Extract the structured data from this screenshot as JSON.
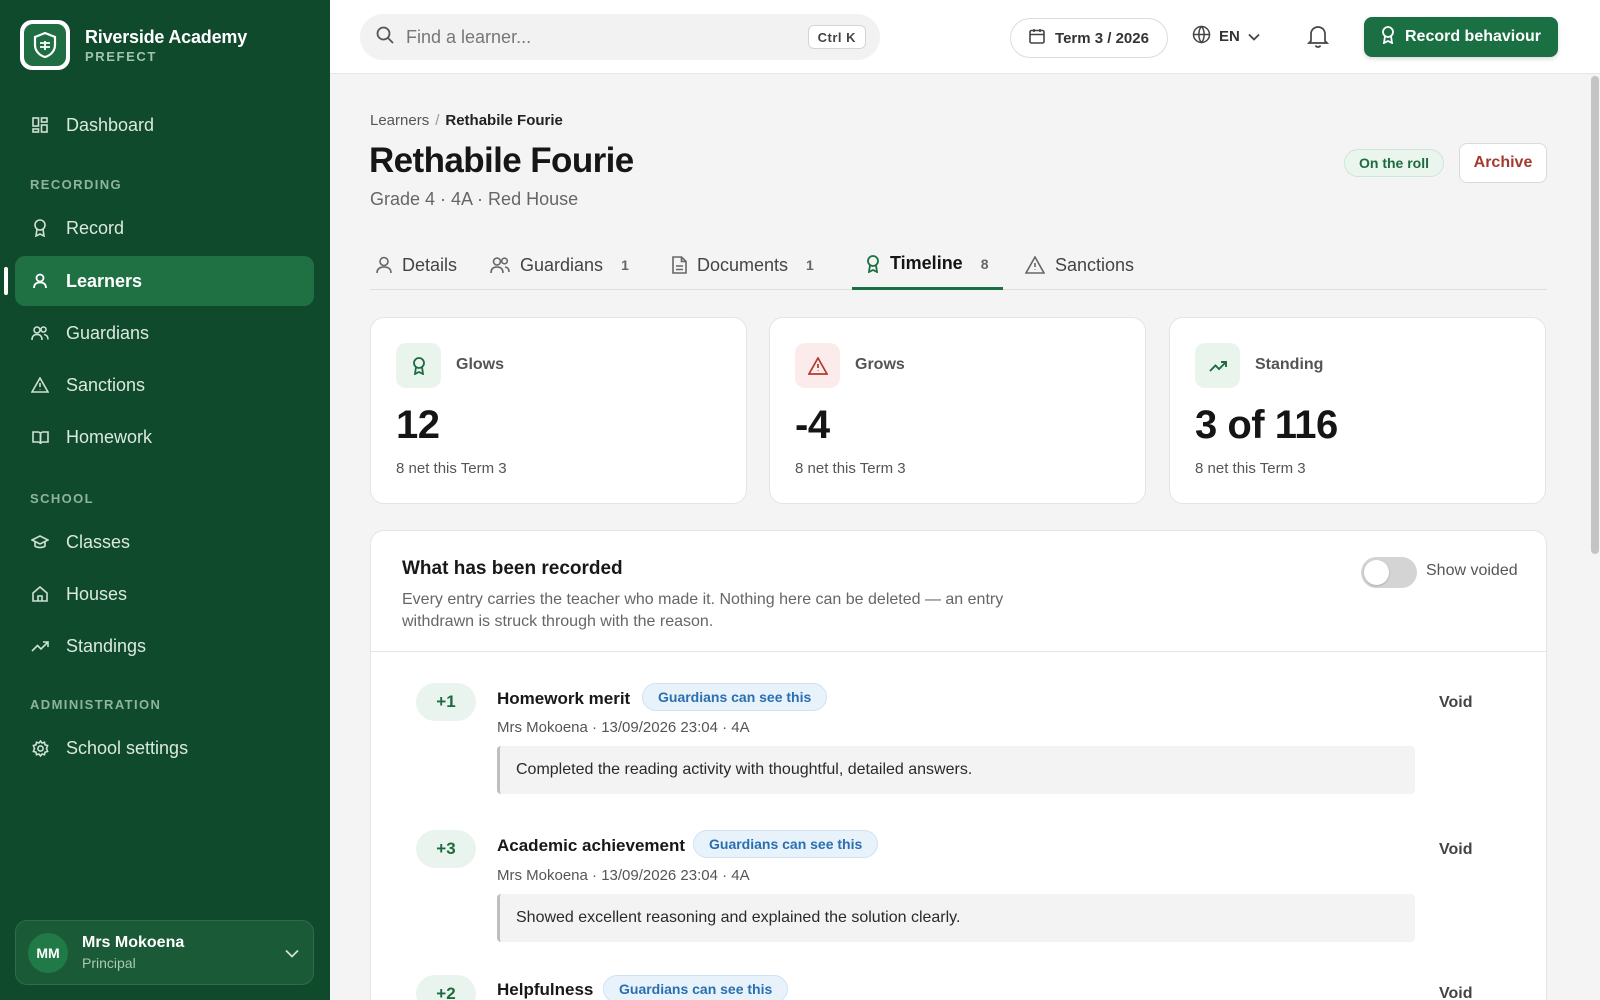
{
  "brand": {
    "name": "Riverside Academy",
    "subtitle": "PREFECT"
  },
  "sidebar": {
    "dashboard": "Dashboard",
    "section_recording": "RECORDING",
    "record": "Record",
    "learners": "Learners",
    "guardians": "Guardians",
    "sanctions": "Sanctions",
    "homework": "Homework",
    "section_school": "SCHOOL",
    "classes": "Classes",
    "houses": "Houses",
    "standings": "Standings",
    "section_admin": "ADMINISTRATION",
    "school_settings": "School settings"
  },
  "user": {
    "initials": "MM",
    "name": "Mrs Mokoena",
    "role": "Principal"
  },
  "topbar": {
    "search_placeholder": "Find a learner...",
    "search_shortcut": "Ctrl K",
    "term": "Term 3 / 2026",
    "language": "EN",
    "primary_action": "Record behaviour"
  },
  "page": {
    "breadcrumb_root": "Learners",
    "breadcrumb_sep": "/",
    "breadcrumb_current": "Rethabile Fourie",
    "title": "Rethabile Fourie",
    "subtitle": "Grade 4 · 4A · Red House",
    "status_badge": "On the roll",
    "archive_label": "Archive"
  },
  "tabs": [
    {
      "label": "Details",
      "count": ""
    },
    {
      "label": "Guardians",
      "count": "1"
    },
    {
      "label": "Documents",
      "count": "1"
    },
    {
      "label": "Timeline",
      "count": "8"
    },
    {
      "label": "Sanctions",
      "count": ""
    }
  ],
  "stats": [
    {
      "label": "Glows",
      "value": "12",
      "note": "8 net this Term 3"
    },
    {
      "label": "Grows",
      "value": "-4",
      "note": "8 net this Term 3"
    },
    {
      "label": "Standing",
      "value": "3 of 116",
      "note": "8 net this Term 3"
    }
  ],
  "records": {
    "title": "What has been recorded",
    "description": "Every entry carries the teacher who made it. Nothing here can be deleted — an entry withdrawn is struck through with the reason.",
    "toggle_label": "Show voided",
    "show_voided": false,
    "entries": [
      {
        "points": "+1",
        "title": "Homework merit",
        "visibility": "Guardians can see this",
        "meta": "Mrs Mokoena · 13/09/2026 23:04 · 4A",
        "note": "Completed the reading activity with thoughtful, detailed answers.",
        "action": "Void"
      },
      {
        "points": "+3",
        "title": "Academic achievement",
        "visibility": "Guardians can see this",
        "meta": "Mrs Mokoena · 13/09/2026 23:04 · 4A",
        "note": "Showed excellent reasoning and explained the solution clearly.",
        "action": "Void"
      },
      {
        "points": "+2",
        "title": "Helpfulness",
        "visibility": "Guardians can see this",
        "action": "Void"
      }
    ]
  },
  "colors": {
    "sidebar_bg": "#0f4a2c",
    "accent": "#1a7043",
    "danger": "#a23b2e",
    "info": "#2a6fb0"
  }
}
